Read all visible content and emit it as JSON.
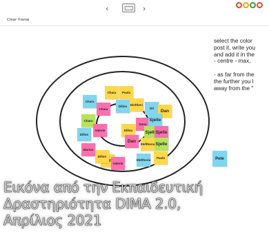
{
  "toolbar": {
    "prev_label": "‹",
    "next_label": "›",
    "clear_label": "Clear frame",
    "logo_colors": [
      "#e8462b",
      "#f4a300",
      "#2e9e44",
      "#e8462b"
    ]
  },
  "instructions": {
    "lines": "select the color\npost it, write you\nand add it in the\n- centre - max,\n\n- as far from the\nthe further you l\naway from the \""
  },
  "board": {
    "notes": [
      {
        "label": "Chara",
        "color": "#ffd84a"
      },
      {
        "label": "Paula",
        "color": "#ffd84a"
      },
      {
        "label": "Chara",
        "color": "#7fd6ef"
      },
      {
        "label": "Chara",
        "color": "#ff6fae"
      },
      {
        "label": "Dillon",
        "color": "#7fd6ef"
      },
      {
        "label": "Eleftheri",
        "color": "#ffd84a"
      },
      {
        "label": "Dil",
        "color": "#7fd6ef"
      },
      {
        "label": "Dan",
        "color": "#ffd84a"
      },
      {
        "label": "Chara",
        "color": "#b6e35a"
      },
      {
        "label": "Dana",
        "color": "#ff6fae"
      },
      {
        "label": "Sjelle",
        "color": "#7fd6ef"
      },
      {
        "label": "Dillon",
        "color": "#ffd84a"
      },
      {
        "label": "Valerie",
        "color": "#ff6fae"
      },
      {
        "label": "Dillon",
        "color": "#7fd6ef"
      },
      {
        "label": "Sjelle",
        "color": "#b6e35a"
      },
      {
        "label": "Sjelle",
        "color": "#ff6fae"
      },
      {
        "label": "Dan",
        "color": "#ff6fae"
      },
      {
        "label": "Marios",
        "color": "#ff6fae"
      },
      {
        "label": "Eleftheria",
        "color": "#ffd84a"
      },
      {
        "label": "Sjelle",
        "color": "#b6e35a"
      },
      {
        "label": "Dan",
        "color": "#ffd84a"
      },
      {
        "label": "Dillon",
        "color": "#ffd84a"
      },
      {
        "label": "Valerie",
        "color": "#ff6fae"
      },
      {
        "label": "Eleftheria",
        "color": "#7fd6ef"
      },
      {
        "label": "Paula",
        "color": "#ffd84a"
      },
      {
        "label": "Pete",
        "color": "#7fd6ef"
      }
    ]
  },
  "caption": {
    "text": "Εικόνα από την Εκπαιδευτική\nΔραστηριότητα DIMA 2.0,\nΑπρίλιος 2021"
  }
}
